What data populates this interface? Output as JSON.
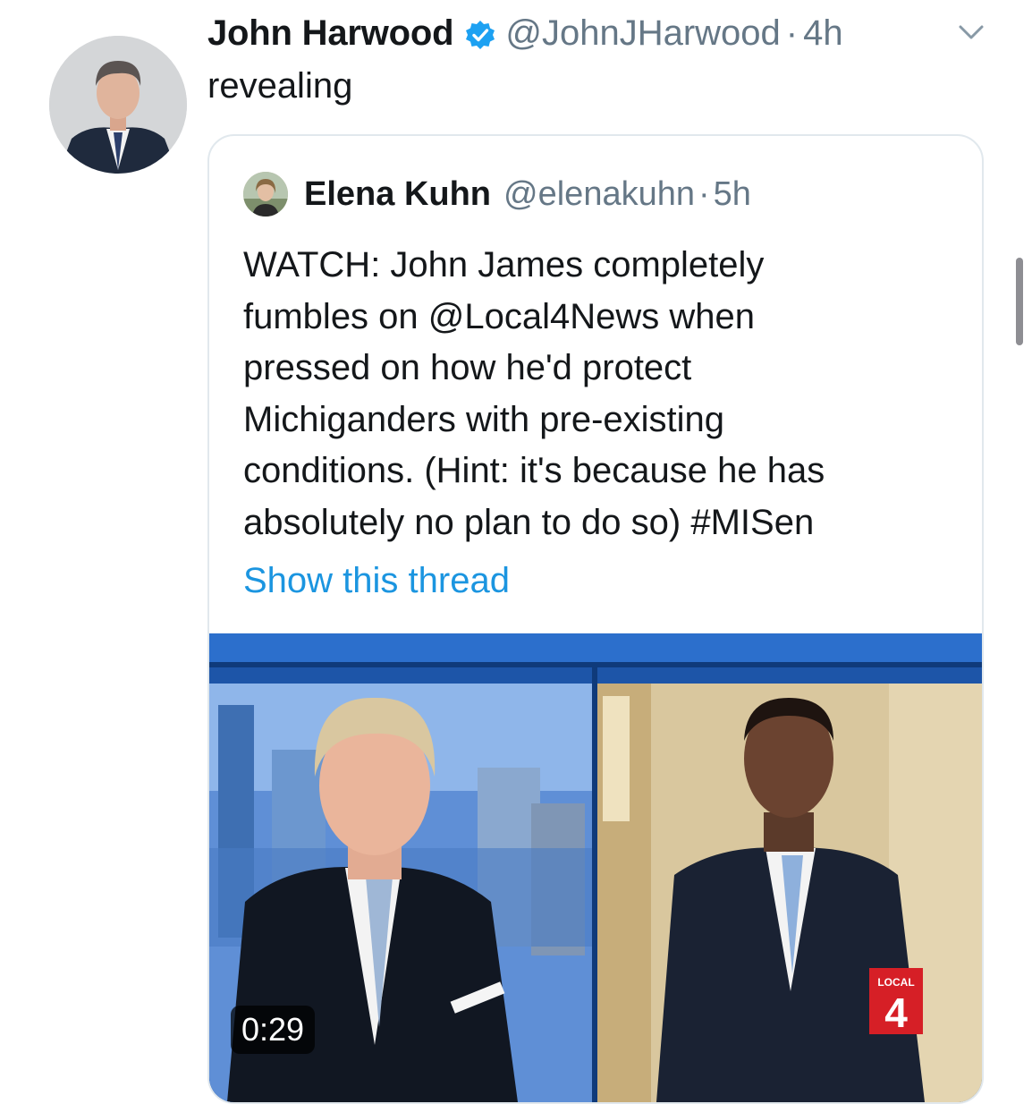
{
  "tweet": {
    "author_name": "John Harwood",
    "author_handle": "@JohnJHarwood",
    "separator": "·",
    "time": "4h",
    "text": "revealing",
    "avatar_icon": "author-avatar",
    "verified_icon": "verified-badge-icon",
    "menu_icon": "chevron-down-icon"
  },
  "quoted_tweet": {
    "author_name": "Elena Kuhn",
    "author_handle": "@elenakuhn",
    "separator": "·",
    "time": "5h",
    "text_lines": [
      "WATCH: John James completely",
      "fumbles on @Local4News when",
      "pressed on how he'd protect",
      "Michiganders with pre-existing",
      "conditions. (Hint: it's because he has",
      "absolutely no plan to do so) #MISen"
    ],
    "show_thread_label": "Show this thread",
    "video": {
      "duration": "0:29",
      "station_logo_text": "LOCAL",
      "station_logo_number": "4"
    }
  },
  "colors": {
    "text": "#14171a",
    "secondary": "#657786",
    "link": "#1b95e0",
    "verified": "#1da1f2",
    "border": "#e1e8ed"
  }
}
